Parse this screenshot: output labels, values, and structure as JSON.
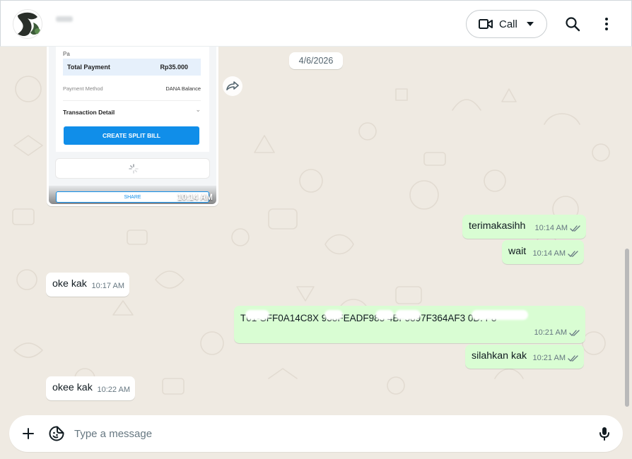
{
  "header": {
    "contact_name": "...",
    "call_label": "Call"
  },
  "chat": {
    "date_chip": "4/6/2026",
    "receipt": {
      "partial_label": "Pa",
      "total_label": "Total Payment",
      "total_value": "Rp35.000",
      "method_label": "Payment Method",
      "method_value": "DANA Balance",
      "detail_label": "Transaction Detail",
      "split_button": "CREATE SPLIT BILL",
      "share_button": "SHARE",
      "time": "10:14 AM"
    },
    "messages": [
      {
        "dir": "out",
        "text": "terimakasihh",
        "time": "10:14 AM",
        "status": "read"
      },
      {
        "dir": "out",
        "text": "wait",
        "time": "10:14 AM",
        "status": "read"
      },
      {
        "dir": "in",
        "text": "oke kak",
        "time": "10:17 AM"
      },
      {
        "dir": "out",
        "text": "T01-SFF0A14C8X 938FEADF983 4BF5897F364AF3 0D. F8",
        "time": "10:21 AM",
        "status": "read"
      },
      {
        "dir": "out",
        "text": "silahkan kak",
        "time": "10:21 AM",
        "status": "read"
      },
      {
        "dir": "in",
        "text": "okee kak",
        "time": "10:22 AM"
      }
    ]
  },
  "composer": {
    "placeholder": "Type a message"
  },
  "colors": {
    "outgoing_bubble": "#d9fdd3",
    "incoming_bubble": "#ffffff",
    "chat_background": "#efeae2",
    "read_ticks": "#667781"
  }
}
